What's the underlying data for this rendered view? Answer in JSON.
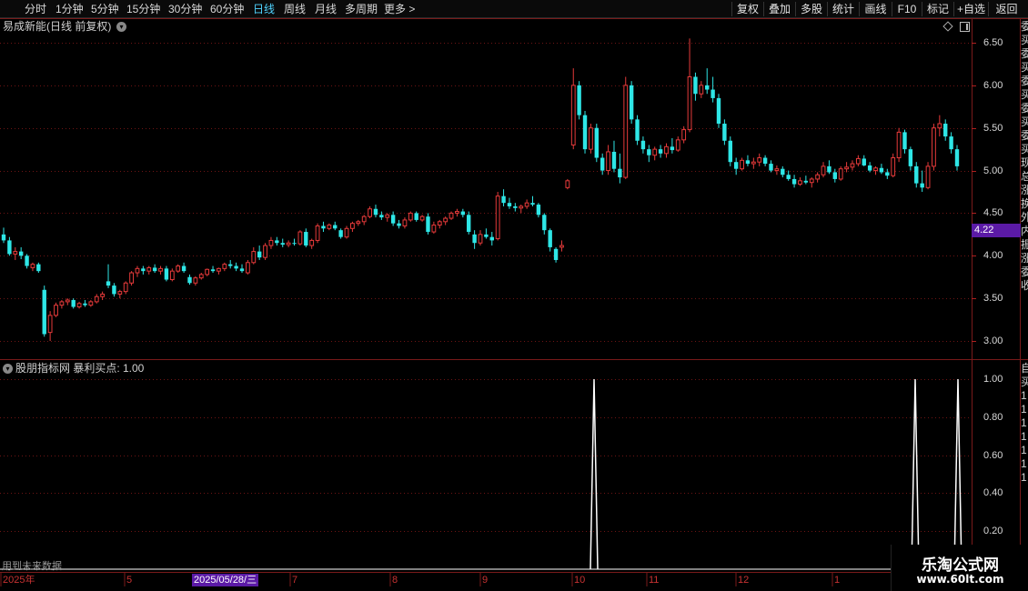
{
  "toolbar": {
    "timeframes": [
      "分时",
      "1分钟",
      "5分钟",
      "15分钟",
      "30分钟",
      "60分钟",
      "日线",
      "周线",
      "月线",
      "多周期",
      "更多 >"
    ],
    "active_timeframe": "日线",
    "actions": [
      "复权",
      "叠加",
      "多股",
      "统计",
      "画线",
      "F10",
      "标记",
      "+自选",
      "返回"
    ]
  },
  "chart": {
    "title": "易成新能(日线 前复权)",
    "last_price": "4.22",
    "y_ticks": [
      "6.50",
      "6.00",
      "5.50",
      "5.00",
      "4.50",
      "4.00",
      "3.50",
      "3.00"
    ]
  },
  "indicator": {
    "title": "股朋指标网  暴利买点: 1.00",
    "y_ticks": [
      "1.00",
      "0.80",
      "0.60",
      "0.40",
      "0.20"
    ],
    "future_note": "用到未来数据",
    "signals": [
      {
        "date": "2025/10/09",
        "value": 1.0
      },
      {
        "date": "2026/01",
        "value": 1.0
      },
      {
        "date": "2026/01",
        "value": 1.0
      }
    ]
  },
  "x_axis": {
    "labels": [
      "2025年",
      "5",
      "7",
      "8",
      "9",
      "10",
      "11",
      "12",
      "1"
    ],
    "highlight_date": "2025/05/28/三"
  },
  "sidebar_text": "委买委买委买委买委买现总涨换外内振涨委收",
  "sidebar_text_lower": "自买1111111",
  "watermark": {
    "line1": "乐淘公式网",
    "line2": "www.60lt.com"
  },
  "colors": {
    "up": "#e63a3a",
    "down": "#2ee6e6",
    "grid": "#6e1414",
    "highlight": "#5b1aa6"
  },
  "chart_data": {
    "type": "candlestick",
    "title": "易成新能(日线 前复权)",
    "ylim": [
      2.85,
      6.65
    ],
    "candles": [
      [
        4.25,
        4.33,
        4.15,
        4.18
      ],
      [
        4.18,
        4.22,
        4.0,
        4.02
      ],
      [
        4.02,
        4.1,
        3.95,
        4.05
      ],
      [
        4.05,
        4.1,
        3.96,
        4.0
      ],
      [
        4.0,
        4.02,
        3.85,
        3.88
      ],
      [
        3.86,
        3.92,
        3.82,
        3.9
      ],
      [
        3.9,
        3.92,
        3.8,
        3.82
      ],
      [
        3.6,
        3.65,
        3.05,
        3.08
      ],
      [
        3.1,
        3.35,
        3.0,
        3.3
      ],
      [
        3.3,
        3.45,
        3.28,
        3.42
      ],
      [
        3.42,
        3.48,
        3.38,
        3.46
      ],
      [
        3.46,
        3.5,
        3.42,
        3.48
      ],
      [
        3.48,
        3.5,
        3.38,
        3.4
      ],
      [
        3.4,
        3.46,
        3.38,
        3.44
      ],
      [
        3.44,
        3.48,
        3.4,
        3.42
      ],
      [
        3.42,
        3.48,
        3.4,
        3.46
      ],
      [
        3.46,
        3.55,
        3.44,
        3.52
      ],
      [
        3.52,
        3.58,
        3.48,
        3.55
      ],
      [
        3.7,
        3.9,
        3.62,
        3.65
      ],
      [
        3.65,
        3.68,
        3.52,
        3.55
      ],
      [
        3.55,
        3.6,
        3.5,
        3.58
      ],
      [
        3.58,
        3.7,
        3.55,
        3.68
      ],
      [
        3.68,
        3.82,
        3.65,
        3.8
      ],
      [
        3.8,
        3.88,
        3.75,
        3.85
      ],
      [
        3.85,
        3.88,
        3.78,
        3.82
      ],
      [
        3.82,
        3.88,
        3.78,
        3.86
      ],
      [
        3.86,
        3.9,
        3.8,
        3.82
      ],
      [
        3.82,
        3.88,
        3.78,
        3.85
      ],
      [
        3.85,
        3.88,
        3.7,
        3.72
      ],
      [
        3.72,
        3.85,
        3.7,
        3.82
      ],
      [
        3.82,
        3.9,
        3.8,
        3.88
      ],
      [
        3.88,
        3.92,
        3.8,
        3.82
      ],
      [
        3.75,
        3.78,
        3.66,
        3.68
      ],
      [
        3.68,
        3.76,
        3.65,
        3.74
      ],
      [
        3.74,
        3.8,
        3.72,
        3.78
      ],
      [
        3.78,
        3.85,
        3.76,
        3.84
      ],
      [
        3.84,
        3.88,
        3.8,
        3.82
      ],
      [
        3.82,
        3.86,
        3.78,
        3.85
      ],
      [
        3.85,
        3.92,
        3.82,
        3.9
      ],
      [
        3.9,
        3.95,
        3.85,
        3.88
      ],
      [
        3.88,
        3.92,
        3.82,
        3.85
      ],
      [
        3.85,
        3.9,
        3.8,
        3.82
      ],
      [
        3.8,
        3.95,
        3.78,
        3.92
      ],
      [
        3.92,
        4.1,
        3.9,
        4.05
      ],
      [
        4.05,
        4.12,
        3.95,
        3.98
      ],
      [
        3.98,
        4.15,
        3.95,
        4.12
      ],
      [
        4.12,
        4.22,
        4.08,
        4.18
      ],
      [
        4.18,
        4.22,
        4.12,
        4.15
      ],
      [
        4.15,
        4.2,
        4.1,
        4.13
      ],
      [
        4.13,
        4.18,
        4.1,
        4.15
      ],
      [
        4.15,
        4.2,
        4.12,
        4.14
      ],
      [
        4.14,
        4.3,
        4.12,
        4.28
      ],
      [
        4.28,
        4.32,
        4.1,
        4.12
      ],
      [
        4.12,
        4.2,
        4.08,
        4.18
      ],
      [
        4.18,
        4.38,
        4.15,
        4.35
      ],
      [
        4.35,
        4.4,
        4.28,
        4.32
      ],
      [
        4.32,
        4.38,
        4.3,
        4.36
      ],
      [
        4.36,
        4.4,
        4.3,
        4.32
      ],
      [
        4.3,
        4.32,
        4.2,
        4.22
      ],
      [
        4.22,
        4.35,
        4.2,
        4.32
      ],
      [
        4.32,
        4.4,
        4.28,
        4.38
      ],
      [
        4.38,
        4.42,
        4.35,
        4.4
      ],
      [
        4.4,
        4.48,
        4.36,
        4.46
      ],
      [
        4.46,
        4.58,
        4.44,
        4.55
      ],
      [
        4.55,
        4.6,
        4.45,
        4.48
      ],
      [
        4.48,
        4.52,
        4.42,
        4.45
      ],
      [
        4.45,
        4.5,
        4.4,
        4.48
      ],
      [
        4.48,
        4.52,
        4.35,
        4.38
      ],
      [
        4.38,
        4.42,
        4.32,
        4.35
      ],
      [
        4.35,
        4.45,
        4.32,
        4.42
      ],
      [
        4.42,
        4.52,
        4.4,
        4.5
      ],
      [
        4.5,
        4.52,
        4.4,
        4.42
      ],
      [
        4.42,
        4.48,
        4.4,
        4.46
      ],
      [
        4.46,
        4.5,
        4.25,
        4.28
      ],
      [
        4.28,
        4.4,
        4.26,
        4.36
      ],
      [
        4.36,
        4.42,
        4.32,
        4.4
      ],
      [
        4.4,
        4.46,
        4.36,
        4.44
      ],
      [
        4.44,
        4.52,
        4.42,
        4.5
      ],
      [
        4.5,
        4.55,
        4.46,
        4.52
      ],
      [
        4.52,
        4.55,
        4.45,
        4.48
      ],
      [
        4.48,
        4.52,
        4.25,
        4.28
      ],
      [
        4.25,
        4.3,
        4.08,
        4.15
      ],
      [
        4.15,
        4.3,
        4.12,
        4.25
      ],
      [
        4.25,
        4.32,
        4.2,
        4.22
      ],
      [
        4.22,
        4.28,
        4.12,
        4.18
      ],
      [
        4.2,
        4.75,
        4.18,
        4.7
      ],
      [
        4.7,
        4.78,
        4.58,
        4.62
      ],
      [
        4.62,
        4.68,
        4.55,
        4.58
      ],
      [
        4.58,
        4.62,
        4.52,
        4.56
      ],
      [
        4.56,
        4.6,
        4.5,
        4.58
      ],
      [
        4.58,
        4.66,
        4.55,
        4.62
      ],
      [
        4.62,
        4.7,
        4.58,
        4.6
      ],
      [
        4.6,
        4.62,
        4.45,
        4.48
      ],
      [
        4.48,
        4.5,
        4.25,
        4.3
      ],
      [
        4.3,
        4.32,
        4.05,
        4.1
      ],
      [
        4.08,
        4.1,
        3.92,
        3.95
      ],
      [
        4.1,
        4.18,
        4.05,
        4.12
      ],
      [
        4.8,
        4.9,
        4.78,
        4.88
      ],
      [
        5.3,
        6.2,
        5.25,
        6.0
      ],
      [
        6.0,
        6.05,
        5.6,
        5.65
      ],
      [
        5.65,
        5.7,
        5.2,
        5.25
      ],
      [
        5.25,
        5.55,
        5.2,
        5.5
      ],
      [
        5.5,
        5.55,
        5.1,
        5.15
      ],
      [
        5.15,
        5.2,
        4.95,
        5.0
      ],
      [
        5.0,
        5.3,
        4.95,
        5.22
      ],
      [
        5.22,
        5.35,
        4.98,
        5.02
      ],
      [
        5.02,
        5.2,
        4.85,
        4.92
      ],
      [
        4.92,
        6.1,
        4.9,
        6.0
      ],
      [
        6.0,
        6.05,
        5.55,
        5.6
      ],
      [
        5.6,
        5.65,
        5.3,
        5.35
      ],
      [
        5.35,
        5.4,
        5.2,
        5.25
      ],
      [
        5.25,
        5.3,
        5.1,
        5.18
      ],
      [
        5.18,
        5.28,
        5.12,
        5.25
      ],
      [
        5.25,
        5.3,
        5.15,
        5.2
      ],
      [
        5.2,
        5.32,
        5.15,
        5.28
      ],
      [
        5.28,
        5.38,
        5.2,
        5.24
      ],
      [
        5.24,
        5.4,
        5.22,
        5.36
      ],
      [
        5.36,
        5.52,
        5.32,
        5.48
      ],
      [
        5.48,
        6.55,
        5.45,
        6.1
      ],
      [
        6.1,
        6.15,
        5.82,
        5.9
      ],
      [
        5.9,
        6.05,
        5.85,
        6.0
      ],
      [
        6.0,
        6.2,
        5.9,
        5.95
      ],
      [
        5.95,
        6.1,
        5.8,
        5.85
      ],
      [
        5.85,
        5.9,
        5.5,
        5.55
      ],
      [
        5.55,
        5.6,
        5.3,
        5.35
      ],
      [
        5.35,
        5.4,
        5.05,
        5.1
      ],
      [
        5.1,
        5.15,
        4.95,
        5.02
      ],
      [
        5.02,
        5.15,
        5.0,
        5.12
      ],
      [
        5.12,
        5.18,
        5.05,
        5.08
      ],
      [
        5.08,
        5.15,
        5.02,
        5.1
      ],
      [
        5.1,
        5.2,
        5.05,
        5.15
      ],
      [
        5.15,
        5.18,
        5.05,
        5.08
      ],
      [
        5.08,
        5.12,
        4.98,
        5.0
      ],
      [
        5.0,
        5.06,
        4.95,
        5.02
      ],
      [
        5.02,
        5.05,
        4.92,
        4.95
      ],
      [
        4.95,
        5.0,
        4.88,
        4.9
      ],
      [
        4.9,
        4.95,
        4.8,
        4.84
      ],
      [
        4.84,
        4.92,
        4.82,
        4.88
      ],
      [
        4.88,
        4.94,
        4.84,
        4.86
      ],
      [
        4.86,
        4.92,
        4.8,
        4.9
      ],
      [
        4.9,
        4.98,
        4.86,
        4.95
      ],
      [
        4.95,
        5.1,
        4.92,
        5.05
      ],
      [
        5.05,
        5.12,
        4.96,
        4.98
      ],
      [
        4.98,
        5.02,
        4.86,
        4.9
      ],
      [
        4.9,
        5.05,
        4.88,
        5.02
      ],
      [
        5.02,
        5.1,
        4.98,
        5.04
      ],
      [
        5.04,
        5.12,
        5.0,
        5.08
      ],
      [
        5.08,
        5.18,
        5.05,
        5.14
      ],
      [
        5.14,
        5.18,
        5.05,
        5.06
      ],
      [
        5.06,
        5.1,
        4.98,
        5.0
      ],
      [
        5.0,
        5.05,
        4.95,
        5.03
      ],
      [
        5.03,
        5.08,
        4.96,
        4.98
      ],
      [
        4.98,
        5.02,
        4.9,
        4.94
      ],
      [
        4.94,
        5.2,
        4.92,
        5.15
      ],
      [
        5.15,
        5.5,
        5.1,
        5.45
      ],
      [
        5.45,
        5.48,
        5.2,
        5.25
      ],
      [
        5.25,
        5.28,
        5.0,
        5.05
      ],
      [
        5.05,
        5.1,
        4.8,
        4.85
      ],
      [
        4.85,
        5.0,
        4.75,
        4.8
      ],
      [
        4.8,
        5.1,
        4.78,
        5.05
      ],
      [
        5.05,
        5.55,
        5.0,
        5.5
      ],
      [
        5.5,
        5.65,
        5.4,
        5.55
      ],
      [
        5.55,
        5.6,
        5.35,
        5.4
      ],
      [
        5.4,
        5.45,
        5.2,
        5.25
      ],
      [
        5.25,
        5.3,
        5.0,
        5.05
      ]
    ]
  }
}
